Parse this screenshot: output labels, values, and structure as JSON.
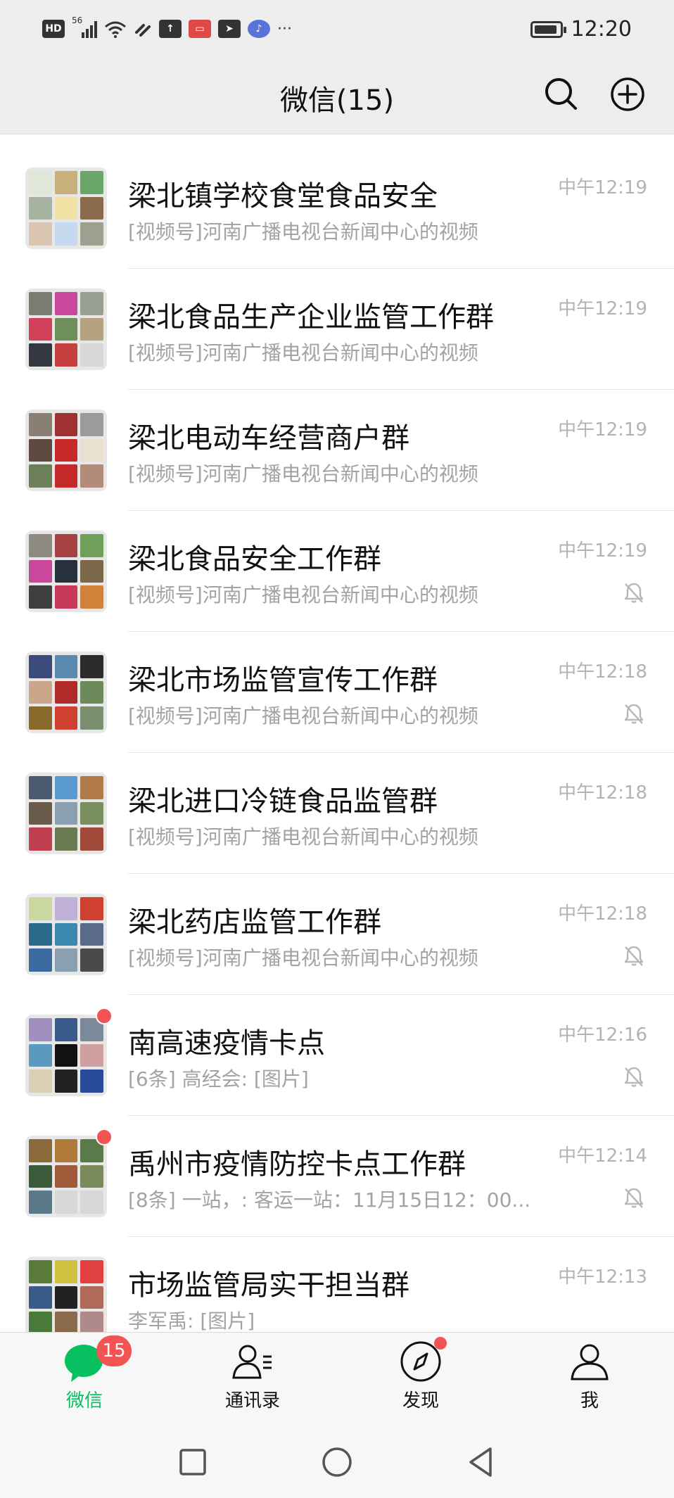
{
  "status_bar": {
    "network_label": "HD",
    "signal_label": "56",
    "time": "12:20",
    "overflow": "···",
    "battery_level": 0.9
  },
  "header": {
    "title": "微信(15)",
    "search_icon": "search-icon",
    "add_icon": "plus-circle-icon"
  },
  "chats": [
    {
      "name": "梁北镇学校食堂食品安全",
      "preview": "[视频号]河南广播电视台新闻中心的视频",
      "time": "中午12:19",
      "muted": false,
      "unread_dot": false,
      "tiles": [
        "#dfe7d8",
        "#c8b07a",
        "#6aa56a",
        "#a6b3a0",
        "#f3e2a5",
        "#8a6a4a",
        "#d9c5b0",
        "#c7d9ee",
        "#9ca08e"
      ]
    },
    {
      "name": "梁北食品生产企业监管工作群",
      "preview": "[视频号]河南广播电视台新闻中心的视频",
      "time": "中午12:19",
      "muted": false,
      "unread_dot": false,
      "tiles": [
        "#7a7d72",
        "#c9489c",
        "#9aa091",
        "#d14058",
        "#6e8e5a",
        "#b7a27f",
        "#333840",
        "#c64040",
        "#d8d8d8"
      ]
    },
    {
      "name": "梁北电动车经营商户群",
      "preview": "[视频号]河南广播电视台新闻中心的视频",
      "time": "中午12:19",
      "muted": false,
      "unread_dot": false,
      "tiles": [
        "#8a7f73",
        "#a13030",
        "#9b9b9b",
        "#5e4a3f",
        "#c62a2a",
        "#e9e0d0",
        "#6d7f5a",
        "#c42a2a",
        "#b48a7a"
      ]
    },
    {
      "name": "梁北食品安全工作群",
      "preview": "[视频号]河南广播电视台新闻中心的视频",
      "time": "中午12:19",
      "muted": true,
      "unread_dot": false,
      "tiles": [
        "#8e8a80",
        "#a64242",
        "#6fa05a",
        "#c9489c",
        "#27303d",
        "#7a6848",
        "#3f3f3f",
        "#c73a5a",
        "#d0823a"
      ]
    },
    {
      "name": "梁北市场监管宣传工作群",
      "preview": "[视频号]河南广播电视台新闻中心的视频",
      "time": "中午12:18",
      "muted": true,
      "unread_dot": false,
      "tiles": [
        "#3a4a7a",
        "#5a8ab0",
        "#2b2b2b",
        "#caa78a",
        "#b02a2a",
        "#6d8a5a",
        "#8a6a2a",
        "#d04030",
        "#7a8f70"
      ]
    },
    {
      "name": "梁北进口冷链食品监管群",
      "preview": "[视频号]河南广播电视台新闻中心的视频",
      "time": "中午12:18",
      "muted": false,
      "unread_dot": false,
      "tiles": [
        "#4a5a70",
        "#5a9ad0",
        "#b07a4a",
        "#6a5a4a",
        "#8aa0b0",
        "#7a8f60",
        "#c04050",
        "#6a7a50",
        "#a04a3a"
      ]
    },
    {
      "name": "梁北药店监管工作群",
      "preview": "[视频号]河南广播电视台新闻中心的视频",
      "time": "中午12:18",
      "muted": true,
      "unread_dot": false,
      "tiles": [
        "#c8d8a0",
        "#c0b0d8",
        "#d04030",
        "#2a6a8a",
        "#3a8ab0",
        "#5a6a8a",
        "#3a6aa0",
        "#8aa0b0",
        "#4a4a4a"
      ]
    },
    {
      "name": "南高速疫情卡点",
      "preview": "[6条] 高经会: [图片]",
      "time": "中午12:16",
      "muted": true,
      "unread_dot": true,
      "tiles": [
        "#a090c0",
        "#3a5a8a",
        "#7a8a9a",
        "#5a9ac0",
        "#111111",
        "#d0a0a0",
        "#d8d0b0",
        "#222222",
        "#2a4a9a"
      ]
    },
    {
      "name": "禹州市疫情防控卡点工作群",
      "preview": "[8条] 一站，: 客运一站：11月15日12：00...",
      "time": "中午12:14",
      "muted": true,
      "unread_dot": true,
      "tiles": [
        "#8a6a3a",
        "#b07a3a",
        "#5a7a4a",
        "#3a5a3a",
        "#a05a3a",
        "#7a8a5a",
        "#5a7a8a",
        "#d8d8d8",
        "#d8d8d8"
      ]
    },
    {
      "name": "市场监管局实干担当群",
      "preview": "李军禹: [图片]",
      "time": "中午12:13",
      "muted": false,
      "unread_dot": false,
      "tiles": [
        "#5a7a3a",
        "#d0c040",
        "#e04040",
        "#3a5a8a",
        "#222222",
        "#b06a5a",
        "#4a7a3a",
        "#8a6a4a",
        "#b08a8a"
      ]
    }
  ],
  "tabbar": {
    "tabs": [
      {
        "label": "微信",
        "badge": "15",
        "active": true
      },
      {
        "label": "通讯录",
        "active": false
      },
      {
        "label": "发现",
        "dot": true,
        "active": false
      },
      {
        "label": "我",
        "active": false
      }
    ]
  },
  "colors": {
    "accent": "#07c160",
    "badge": "#f25353",
    "header_bg": "#ededed",
    "secondary_text": "#a3a3a3"
  }
}
